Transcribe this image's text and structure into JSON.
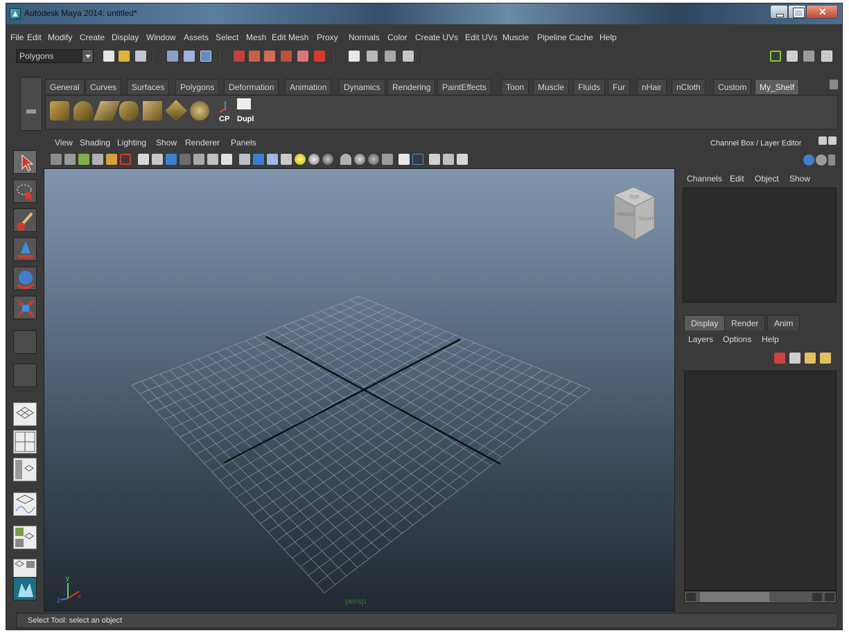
{
  "window": {
    "title": "Autodesk Maya 2014: untitled*"
  },
  "menubar": [
    "File",
    "Edit",
    "Modify",
    "Create",
    "Display",
    "Window",
    "Assets",
    "Select",
    "Mesh",
    "Edit Mesh",
    "Proxy",
    "Normals",
    "Color",
    "Create UVs",
    "Edit UVs",
    "Muscle",
    "Pipeline Cache",
    "Help"
  ],
  "statusline": {
    "mode": "Polygons"
  },
  "shelf": {
    "tabs": [
      "General",
      "Curves",
      "Surfaces",
      "Polygons",
      "Deformation",
      "Animation",
      "Dynamics",
      "Rendering",
      "PaintEffects",
      "Toon",
      "Muscle",
      "Fluids",
      "Fur",
      "nHair",
      "nCloth",
      "Custom",
      "My_Shelf"
    ],
    "active_tab": "My_Shelf",
    "buttons": [
      "CP",
      "Dupl"
    ]
  },
  "panel": {
    "menus": [
      "View",
      "Shading",
      "Lighting",
      "Show",
      "Renderer",
      "Panels"
    ],
    "camera_label": "persp",
    "axis": {
      "x": "x",
      "y": "y",
      "z": "z"
    },
    "viewcube": {
      "top": "TOP",
      "front": "FRONT",
      "right": "RIGHT"
    }
  },
  "channel_box": {
    "title": "Channel Box / Layer Editor",
    "menus": [
      "Channels",
      "Edit",
      "Object",
      "Show"
    ]
  },
  "layer_editor": {
    "tabs": [
      "Display",
      "Render",
      "Anim"
    ],
    "active_tab": "Display",
    "menus": [
      "Layers",
      "Options",
      "Help"
    ]
  },
  "helpline": {
    "text": "Select Tool: select an object"
  },
  "colors": {
    "accent": "#4fb3c8",
    "active_tab": "#5d5d5d",
    "selection_red": "#d23a2a"
  }
}
